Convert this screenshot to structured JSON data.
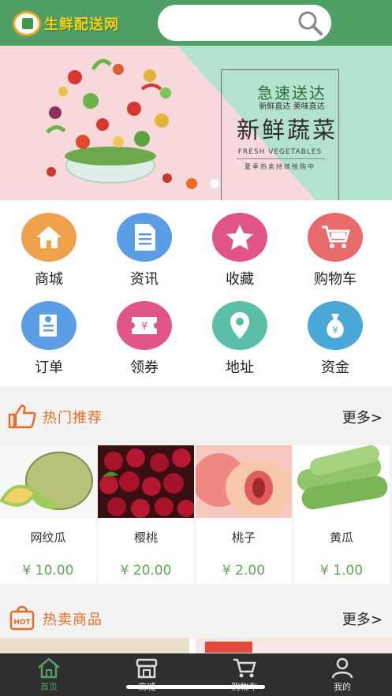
{
  "header": {
    "logo_text": "生鲜配送网",
    "search_placeholder": ""
  },
  "banner": {
    "line1": "急速送达",
    "line2": "新鲜直达  美味直达",
    "line3": "新鲜蔬菜",
    "line4": "FRESH VEGETABLES",
    "line5": "夏季热卖持续抢购中",
    "active_dot": 0
  },
  "categories": [
    {
      "label": "商城",
      "icon": "home-icon",
      "color": "#f0a14c"
    },
    {
      "label": "资讯",
      "icon": "document-icon",
      "color": "#5b9ee6"
    },
    {
      "label": "收藏",
      "icon": "star-icon",
      "color": "#e2558a"
    },
    {
      "label": "购物车",
      "icon": "cart-icon",
      "color": "#e86b6b"
    },
    {
      "label": "订单",
      "icon": "order-icon",
      "color": "#5b9ee6"
    },
    {
      "label": "领券",
      "icon": "coupon-icon",
      "color": "#e2558a"
    },
    {
      "label": "地址",
      "icon": "location-icon",
      "color": "#5bbfa7"
    },
    {
      "label": "资金",
      "icon": "money-bag-icon",
      "color": "#4aa8d6"
    }
  ],
  "hot_recommend": {
    "title": "热门推荐",
    "more": "更多>",
    "items": [
      {
        "name": "网纹瓜",
        "price": "¥ 10.00"
      },
      {
        "name": "樱桃",
        "price": "¥ 20.00"
      },
      {
        "name": "桃子",
        "price": "¥ 2.00"
      },
      {
        "name": "黄瓜",
        "price": "¥ 1.00"
      }
    ]
  },
  "hot_sale": {
    "title": "热卖商品",
    "more": "更多>"
  },
  "tabbar": [
    {
      "label": "首页",
      "icon": "home-tab-icon",
      "active": true
    },
    {
      "label": "商城",
      "icon": "shop-tab-icon",
      "active": false
    },
    {
      "label": "购物车",
      "icon": "cart-tab-icon",
      "active": false
    },
    {
      "label": "我的",
      "icon": "profile-tab-icon",
      "active": false
    }
  ],
  "colors": {
    "brand_green": "#4fa066",
    "accent_orange": "#ea6b24",
    "price_green": "#5caa54",
    "tabbar_bg": "#2f2f2f"
  }
}
